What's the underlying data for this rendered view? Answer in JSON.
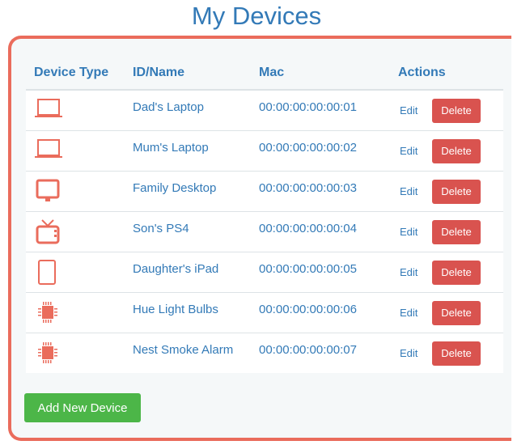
{
  "page": {
    "title": "My Devices"
  },
  "colors": {
    "accent": "#337ab7",
    "border": "#ea6c5c",
    "delete": "#d9534f",
    "add": "#4cb648",
    "icon": "#ea6c5c"
  },
  "table": {
    "headers": [
      "Device Type",
      "ID/Name",
      "Mac",
      "Actions"
    ],
    "rows": [
      {
        "icon": "laptop-icon",
        "name": "Dad's Laptop",
        "mac": "00:00:00:00:00:01",
        "edit": "Edit",
        "delete": "Delete"
      },
      {
        "icon": "laptop-icon",
        "name": "Mum's Laptop",
        "mac": "00:00:00:00:00:02",
        "edit": "Edit",
        "delete": "Delete"
      },
      {
        "icon": "desktop-icon",
        "name": "Family Desktop",
        "mac": "00:00:00:00:00:03",
        "edit": "Edit",
        "delete": "Delete"
      },
      {
        "icon": "tv-icon",
        "name": "Son's PS4",
        "mac": "00:00:00:00:00:04",
        "edit": "Edit",
        "delete": "Delete"
      },
      {
        "icon": "tablet-icon",
        "name": "Daughter's iPad",
        "mac": "00:00:00:00:00:05",
        "edit": "Edit",
        "delete": "Delete"
      },
      {
        "icon": "chip-icon",
        "name": "Hue Light Bulbs",
        "mac": "00:00:00:00:00:06",
        "edit": "Edit",
        "delete": "Delete"
      },
      {
        "icon": "chip-icon",
        "name": "Nest Smoke Alarm",
        "mac": "00:00:00:00:00:07",
        "edit": "Edit",
        "delete": "Delete"
      }
    ]
  },
  "actions": {
    "add_label": "Add New Device"
  }
}
